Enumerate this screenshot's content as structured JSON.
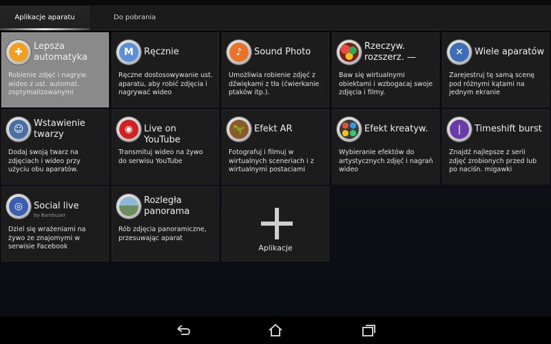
{
  "tabs": [
    {
      "label": "Aplikacje aparatu"
    },
    {
      "label": "Do pobrania"
    }
  ],
  "tiles": [
    {
      "title": "Lepsza automatyka",
      "desc": "Robienie zdjęć i nagryw. wideo z ust. automat. zoptymalizowanymi",
      "icon": "camera-plus-icon",
      "color": "#f0a020"
    },
    {
      "title": "Ręcznie",
      "desc": "Ręczne dostosowywanie ust. aparatu, aby robić zdjęcia i nagrywać wideo",
      "icon": "manual-m-icon",
      "color": "#5b8fd6"
    },
    {
      "title": "Sound Photo",
      "desc": "Umożliwia robienie zdjęć z dźwiękami z tła (ćwierkanie ptaków itp.).",
      "icon": "sound-photo-icon",
      "color": "#e8742a"
    },
    {
      "title": "Rzeczyw. rozszerz. —",
      "desc": "Baw się wirtualnymi obiektami i wzbogacaj swoje zdjęcia i filmy.",
      "icon": "ar-balls-icon",
      "color": "#c0392b"
    },
    {
      "title": "Wiele aparatów",
      "desc": "Zarejestruj tę samą scenę pod różnymi kątami na jednym ekranie",
      "icon": "multi-camera-icon",
      "color": "#3d6fb8"
    },
    {
      "title": "Wstawienie twarzy",
      "desc": "Dodaj swoją twarz na zdjęciach i wideo przy użyciu obu aparatów.",
      "icon": "face-in-icon",
      "color": "#4a6fa5"
    },
    {
      "title": "Live on YouTube",
      "desc": "Transmituj wideo na żywo do serwisu YouTube",
      "icon": "live-broadcast-icon",
      "color": "#d42020"
    },
    {
      "title": "Efekt AR",
      "desc": "Fotografuj i filmuj w wirtualnych sceneriach i z wirtualnymi postaciami",
      "icon": "dinosaur-icon",
      "color": "#8a5a2a"
    },
    {
      "title": "Efekt kreatyw.",
      "desc": "Wybieranie efektów do artystycznych zdjęć i nagrań wideo",
      "icon": "palette-icon",
      "color": "#3a3a3a"
    },
    {
      "title": "Timeshift burst",
      "desc": "Znajdź najlepsze z serii zdjęć zrobionych przed lub po naciśn. migawki",
      "icon": "timeshift-icon",
      "color": "#6a3aa8"
    },
    {
      "title": "Social live",
      "subtitle": "by Bambuser",
      "desc": "Dziel się wrażeniami na żywo ze znajomymi w serwisie Facebook",
      "icon": "social-live-icon",
      "color": "#3a5fb0"
    },
    {
      "title": "Rozległa panorama",
      "desc": "Rób zdjęcia panoramiczne, przesuwając aparat",
      "icon": "panorama-icon",
      "color": "#6b8f5a"
    }
  ],
  "add_tile": {
    "label": "Aplikacje"
  },
  "nav": {
    "back": "back-icon",
    "home": "home-icon",
    "recents": "recents-icon"
  }
}
